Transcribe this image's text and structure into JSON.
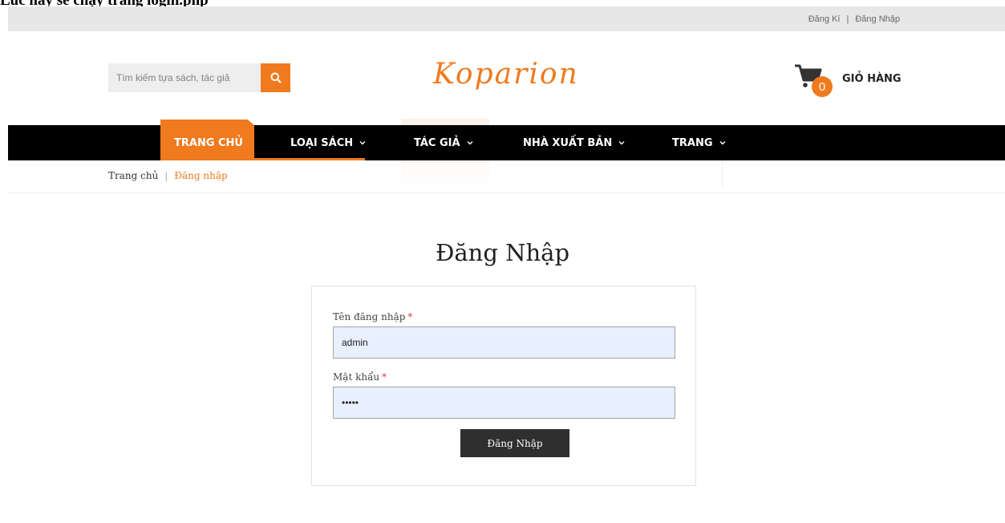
{
  "doc": {
    "caption": "Lúc này sẽ chạy trang login.php"
  },
  "topbar": {
    "register": "Đăng Kí",
    "separator": "|",
    "login": "Đăng Nhập"
  },
  "search": {
    "placeholder": "Tìm kiếm tựa sách, tác giả",
    "icon": "search-icon"
  },
  "brand": {
    "logo": "Koparion",
    "accent": "#f07a1e"
  },
  "cart": {
    "count": "0",
    "label": "GIỎ HÀNG",
    "icon": "cart-icon"
  },
  "nav": {
    "items": [
      {
        "label": "TRANG CHỦ",
        "has_dropdown": false
      },
      {
        "label": "LOẠI SÁCH",
        "has_dropdown": true
      },
      {
        "label": "TÁC GIẢ",
        "has_dropdown": true
      },
      {
        "label": "NHÀ XUẤT BẢN",
        "has_dropdown": true
      },
      {
        "label": "TRANG",
        "has_dropdown": true
      }
    ]
  },
  "breadcrumb": {
    "home": "Trang chủ",
    "separator": "|",
    "current": "Đăng nhập"
  },
  "page": {
    "title": "Đăng Nhập"
  },
  "form": {
    "username_label": "Tên đăng nhập",
    "username_value": "admin",
    "password_label": "Mật khẩu",
    "password_value": "•••••",
    "required_mark": "*",
    "submit_label": "Đăng Nhập"
  }
}
